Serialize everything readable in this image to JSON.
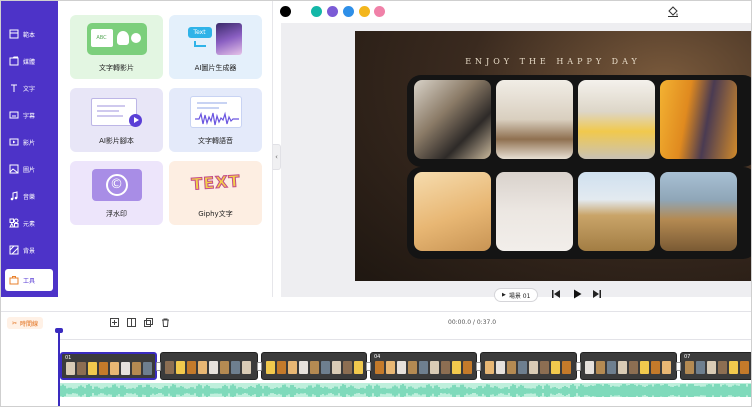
{
  "sidebar": {
    "items": [
      {
        "label": "範本",
        "icon": "template-icon"
      },
      {
        "label": "媒體",
        "icon": "media-icon"
      },
      {
        "label": "文字",
        "icon": "text-icon"
      },
      {
        "label": "字幕",
        "icon": "subtitle-icon"
      },
      {
        "label": "影片",
        "icon": "video-icon"
      },
      {
        "label": "圖片",
        "icon": "image-icon"
      },
      {
        "label": "音樂",
        "icon": "music-icon"
      },
      {
        "label": "元素",
        "icon": "elements-icon"
      },
      {
        "label": "背景",
        "icon": "background-icon"
      },
      {
        "label": "工具",
        "icon": "tools-icon"
      }
    ],
    "active_index": 9
  },
  "tools": {
    "cards": [
      {
        "label": "文字轉影片",
        "icon": "text-to-video-icon",
        "bg": "#e3f6e2",
        "art_text": "ABC"
      },
      {
        "label": "AI圖片生成器",
        "icon": "ai-image-generator-icon",
        "bg": "#e4f0fb",
        "art_text": "Text"
      },
      {
        "label": "AI影片腳本",
        "icon": "ai-video-script-icon",
        "bg": "#e8e6f7",
        "art_text": ""
      },
      {
        "label": "文字轉語音",
        "icon": "text-to-speech-icon",
        "bg": "#e4eafa",
        "art_text": ""
      },
      {
        "label": "浮水印",
        "icon": "watermark-icon",
        "bg": "#ede5fb",
        "art_text": "©"
      },
      {
        "label": "Giphy文字",
        "icon": "giphy-text-icon",
        "bg": "#fdeee2",
        "art_text": "TEXT"
      }
    ]
  },
  "colors": {
    "swatches": [
      "#000000",
      "#13b7a7",
      "#7b5bd6",
      "#2e8fe8",
      "#f3b61d",
      "#f081a8"
    ],
    "accent": "#4d33c8",
    "timeline_accent": "#e2701c",
    "audio": "#3fc59a"
  },
  "slide": {
    "title": "ENJOY THE HAPPY DAY"
  },
  "playback": {
    "scene_label": "場景 01"
  },
  "timeline": {
    "label": "時間線",
    "time": "00:00.0 / 0:37.0",
    "clips": [
      "01",
      "",
      "",
      "04",
      "",
      "",
      "07"
    ]
  }
}
